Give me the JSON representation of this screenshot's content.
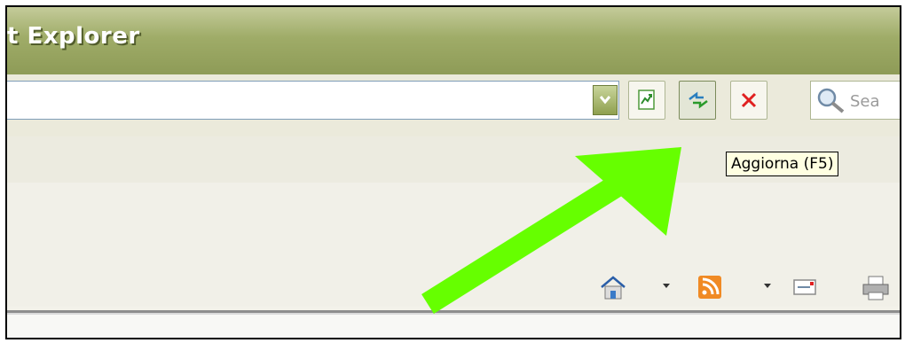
{
  "window": {
    "title": "t Explorer"
  },
  "address_bar": {
    "dropdown_icon": "chevron-down-icon",
    "go_icon": "go-page-icon",
    "refresh_icon": "refresh-icon",
    "stop_icon": "stop-x-icon",
    "search_placeholder": "Sea",
    "search_icon": "magnifier-icon"
  },
  "tooltip": {
    "text": "Aggiorna (F5)"
  },
  "command_bar": {
    "items": [
      "home-icon",
      "rss-feed-icon",
      "mail-icon",
      "print-icon"
    ]
  },
  "annotation": {
    "arrow_color": "#66ff00",
    "arrow_icon": "arrow-icon"
  },
  "colors": {
    "titlebar": "#9fac68",
    "title_text": "#ffffff",
    "accent_arrow": "#66ff00",
    "stop_red": "#e02020",
    "refresh_green": "#2a9a2a"
  }
}
